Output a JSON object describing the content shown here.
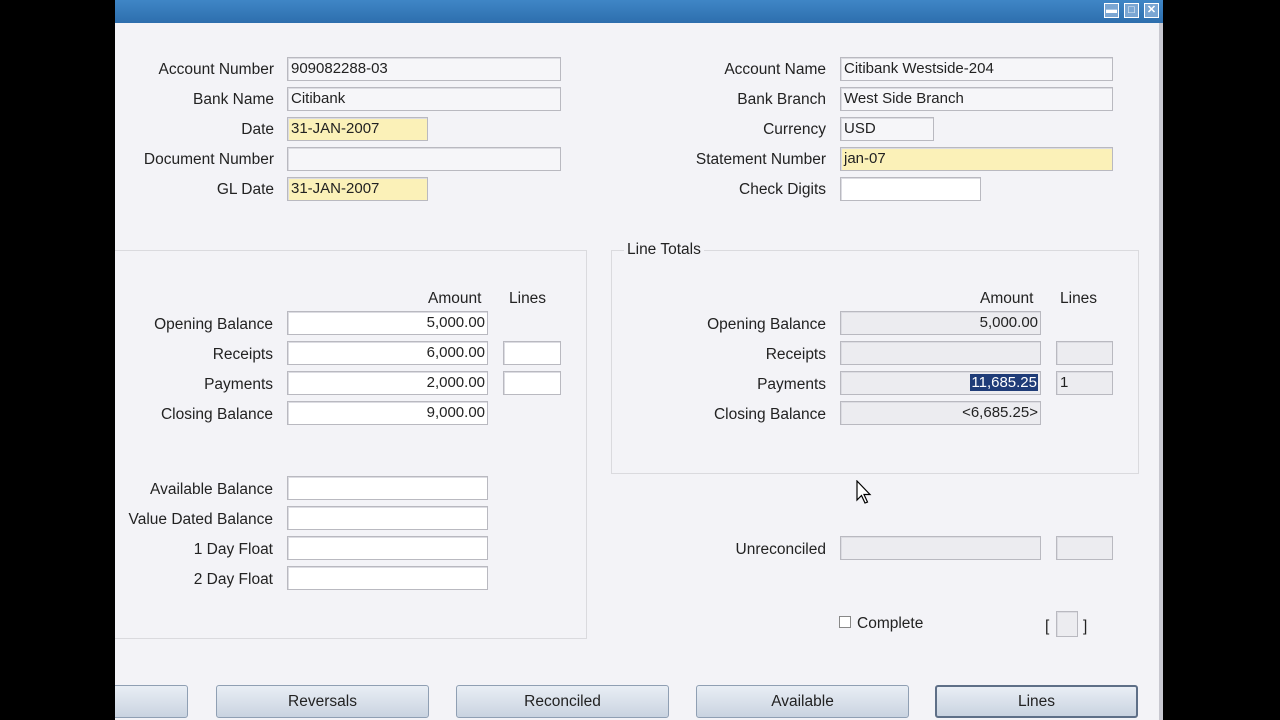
{
  "window": {
    "controls": {
      "minimize": "▬",
      "maximize": "□",
      "close": "✕"
    }
  },
  "header_left": {
    "account_number": {
      "label": "Account Number",
      "value": "909082288-03"
    },
    "bank_name": {
      "label": "Bank Name",
      "value": "Citibank"
    },
    "date": {
      "label": "Date",
      "value": "31-JAN-2007"
    },
    "document_number": {
      "label": "Document Number",
      "value": ""
    },
    "gl_date": {
      "label": "GL Date",
      "value": "31-JAN-2007"
    }
  },
  "header_right": {
    "account_name": {
      "label": "Account Name",
      "value": "Citibank Westside-204"
    },
    "bank_branch": {
      "label": "Bank Branch",
      "value": "West Side Branch"
    },
    "currency": {
      "label": "Currency",
      "value": "USD"
    },
    "statement_number": {
      "label": "Statement Number",
      "value": "jan-07"
    },
    "check_digits": {
      "label": "Check Digits",
      "value": ""
    }
  },
  "control_totals": {
    "col_amount": "Amount",
    "col_lines": "Lines",
    "opening_balance": {
      "label": "Opening Balance",
      "amount": "5,000.00"
    },
    "receipts": {
      "label": "Receipts",
      "amount": "6,000.00",
      "lines": ""
    },
    "payments": {
      "label": "Payments",
      "amount": "2,000.00",
      "lines": ""
    },
    "closing_balance": {
      "label": "Closing Balance",
      "amount": "9,000.00"
    },
    "available_balance": {
      "label": "Available Balance",
      "value": ""
    },
    "value_dated_balance": {
      "label": "Value Dated Balance",
      "value": ""
    },
    "one_day_float": {
      "label": "1 Day Float",
      "value": ""
    },
    "two_day_float": {
      "label": "2 Day Float",
      "value": ""
    }
  },
  "line_totals": {
    "title": "Line Totals",
    "col_amount": "Amount",
    "col_lines": "Lines",
    "opening_balance": {
      "label": "Opening Balance",
      "amount": "5,000.00"
    },
    "receipts": {
      "label": "Receipts",
      "amount": "",
      "lines": ""
    },
    "payments": {
      "label": "Payments",
      "amount": "11,685.25",
      "lines": "1"
    },
    "closing_balance": {
      "label": "Closing Balance",
      "amount": "<6,685.25>"
    }
  },
  "unreconciled": {
    "label": "Unreconciled",
    "amount": "",
    "lines": ""
  },
  "complete": {
    "label": "Complete",
    "checked": false
  },
  "bracket": {
    "open": "[",
    "close": "]"
  },
  "buttons": {
    "reversals": "Reversals",
    "reconciled": "Reconciled",
    "available": "Available",
    "lines": "Lines"
  }
}
